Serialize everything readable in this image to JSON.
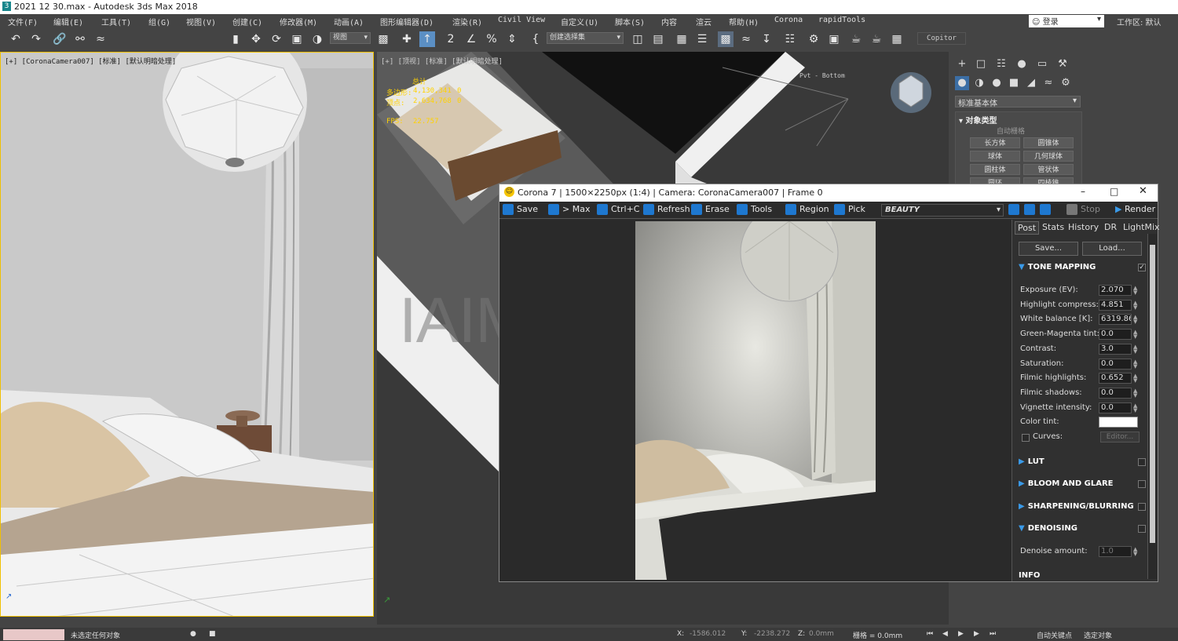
{
  "app": {
    "title": "2021 12 30.max - Autodesk 3ds Max 2018",
    "icon_letter": "3"
  },
  "menu": [
    "文件(F)",
    "编辑(E)",
    "工具(T)",
    "组(G)",
    "视图(V)",
    "创建(C)",
    "修改器(M)",
    "动画(A)",
    "图形编辑器(D)",
    "渲染(R)",
    "Civil View",
    "自定义(U)",
    "脚本(S)",
    "内容",
    "渲云",
    "帮助(H)",
    "Corona",
    "rapidTools"
  ],
  "login": {
    "label": "登录"
  },
  "workspace": {
    "label": "工作区: 默认"
  },
  "toolbar": {
    "view_dropdown": "视图",
    "selection_set": "创建选择集",
    "copitor": "Copitor"
  },
  "viewport_left": {
    "label": "[+] [CoronaCamera007] [标准] [默认明暗处理]"
  },
  "viewport_top": {
    "label": "[+] [顶视] [标准] [默认明暗处理]",
    "stats": {
      "total_label": "总计",
      "poly_label": "多边形:",
      "poly_value": "4,130,341",
      "poly_sel": "0",
      "vert_label": "顶点:",
      "vert_value": "2,634,768",
      "vert_sel": "0",
      "fps_label": "FPS:",
      "fps_value": "22.757"
    },
    "pivot_label": "Pvt - Bottom",
    "watermark": "IAIModel.com"
  },
  "command_panel": {
    "dropdown": "标准基本体",
    "rollout_title": "对象类型",
    "autogrid": "自动栅格",
    "objects": [
      "长方体",
      "圆锥体",
      "球体",
      "几何球体",
      "圆柱体",
      "管状体",
      "圆环",
      "四棱锥"
    ]
  },
  "corona": {
    "title": "Corona 7 | 1500×2250px (1:4) | Camera: CoronaCamera007 | Frame 0",
    "toolbar": {
      "save": "Save",
      "to_max": "> Max",
      "copy": "Ctrl+C",
      "refresh": "Refresh",
      "erase": "Erase",
      "tools": "Tools",
      "region": "Region",
      "pick": "Pick",
      "channel": "BEAUTY",
      "stop": "Stop",
      "render": "Render"
    },
    "tabs": [
      "Post",
      "Stats",
      "History",
      "DR",
      "LightMix"
    ],
    "save_btn": "Save...",
    "load_btn": "Load...",
    "tone_mapping": {
      "title": "TONE MAPPING",
      "rows": [
        {
          "label": "Exposure (EV):",
          "value": "2.070"
        },
        {
          "label": "Highlight compress:",
          "value": "4.851"
        },
        {
          "label": "White balance [K]:",
          "value": "6319.864"
        },
        {
          "label": "Green-Magenta tint:",
          "value": "0.0"
        },
        {
          "label": "Contrast:",
          "value": "3.0"
        },
        {
          "label": "Saturation:",
          "value": "0.0"
        },
        {
          "label": "Filmic highlights:",
          "value": "0.652"
        },
        {
          "label": "Filmic shadows:",
          "value": "0.0"
        },
        {
          "label": "Vignette intensity:",
          "value": "0.0"
        }
      ],
      "color_tint_label": "Color tint:",
      "curves_label": "Curves:",
      "editor_btn": "Editor..."
    },
    "sections": [
      "LUT",
      "BLOOM AND GLARE",
      "SHARPENING/BLURRING"
    ],
    "denoising": {
      "title": "DENOISING",
      "amount_label": "Denoise amount:",
      "amount_value": "1.0"
    },
    "info_title": "INFO"
  },
  "statusbar": {
    "selection": "未选定任何对象",
    "x_label": "X:",
    "x_value": "-1586.012",
    "y_label": "Y:",
    "y_value": "-2238.272",
    "z_label": "Z:",
    "z_value": "0.0mm",
    "grid": "栅格 = 0.0mm",
    "auto_key": "自动关键点",
    "selected": "选定对象"
  }
}
